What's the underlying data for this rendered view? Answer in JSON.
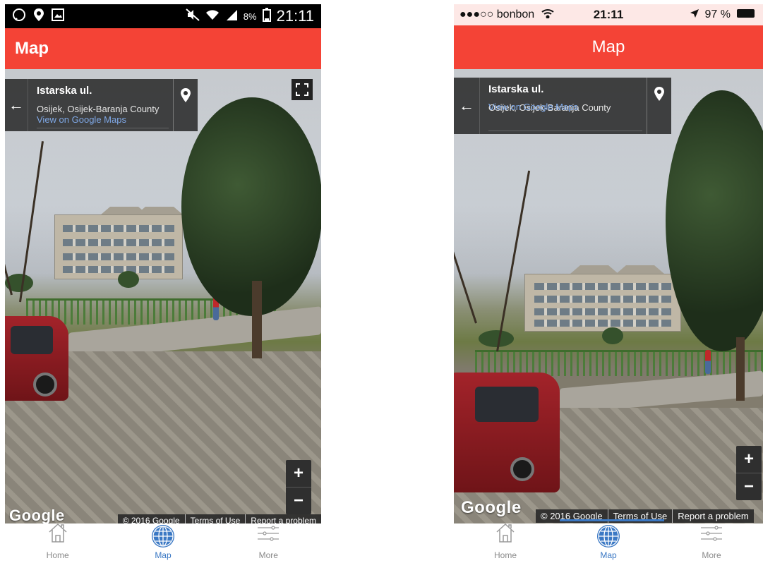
{
  "android": {
    "status": {
      "time": "21:11",
      "battery": "8%"
    },
    "app_title": "Map",
    "card": {
      "street": "Istarska ul.",
      "region": "Osijek, Osijek-Baranja County",
      "link": "View on Google Maps"
    },
    "zoom": {
      "plus": "+",
      "minus": "−"
    },
    "google_logo": "Google",
    "attribution": {
      "copyright": "© 2016 Google",
      "terms": "Terms of Use",
      "report": "Report a problem"
    },
    "tabs": [
      {
        "label": "Home",
        "icon": "home-icon"
      },
      {
        "label": "Map",
        "icon": "globe-icon"
      },
      {
        "label": "More",
        "icon": "sliders-icon"
      }
    ],
    "active_tab": "Map"
  },
  "ios": {
    "status": {
      "carrier": "●●●○○ bonbon",
      "time": "21:11",
      "battery": "97 %"
    },
    "app_title": "Map",
    "card": {
      "street": "Istarska ul.",
      "region": "Osijek, Osijek-Baranja County",
      "link": "View on Google Maps"
    },
    "zoom": {
      "plus": "+",
      "minus": "−"
    },
    "google_logo": "Google",
    "attribution": {
      "copyright": "© 2016 Google",
      "terms": "Terms of Use",
      "report": "Report a problem"
    },
    "tabs": [
      {
        "label": "Home",
        "icon": "home-icon"
      },
      {
        "label": "Map",
        "icon": "globe-icon"
      },
      {
        "label": "More",
        "icon": "sliders-icon"
      }
    ],
    "active_tab": "Map"
  },
  "colors": {
    "accent": "#f44336",
    "tab_active": "#3a78c4",
    "tab_inactive": "#8a8a8a"
  }
}
